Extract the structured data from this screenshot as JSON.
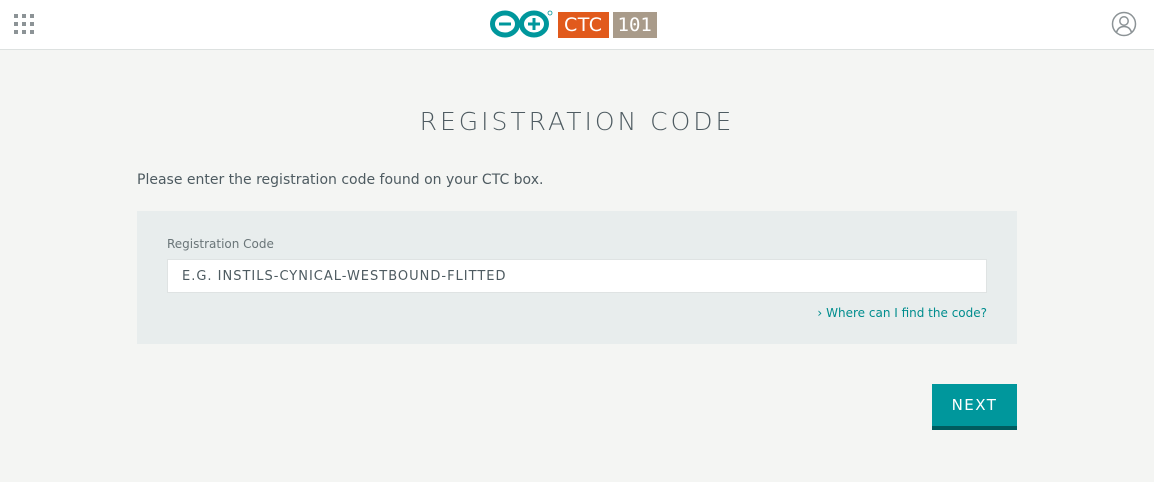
{
  "header": {
    "apps_icon": "grid-apps-icon",
    "logo": {
      "brand_icon": "arduino-infinity-logo",
      "ctc_text": "CTC",
      "course_text": "101",
      "ctc_color": "#e15a1c",
      "course_color": "#a99b8a",
      "brand_color": "#00979c"
    },
    "user_icon": "user-account-icon"
  },
  "main": {
    "title": "REGISTRATION CODE",
    "instructions": "Please enter the registration code found on your CTC box.",
    "form": {
      "label": "Registration Code",
      "value": "",
      "placeholder": "E.G. INSTILS-CYNICAL-WESTBOUND-FLITTED",
      "help_link": "Where can I find the code?"
    },
    "next_label": "NEXT"
  },
  "colors": {
    "accent": "#00979c",
    "accent_dark": "#005c5f",
    "link": "#008d8e",
    "background": "#f4f5f3",
    "panel": "#e8eded"
  }
}
